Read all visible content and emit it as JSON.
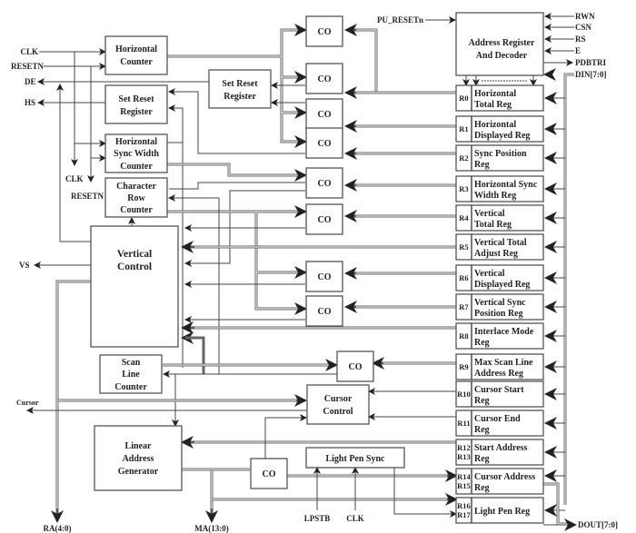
{
  "diagram": {
    "blocks": {
      "horizontal_counter": [
        "Horizontal",
        "Counter"
      ],
      "set_reset_register_1": [
        "Set Reset",
        "Register"
      ],
      "set_reset_register_2": [
        "Set Reset",
        "Register"
      ],
      "hsync_width_counter": [
        "Horizontal",
        "Sync Width",
        "Counter"
      ],
      "char_row_counter": [
        "Character",
        "Row",
        "Counter"
      ],
      "vertical_control": [
        "Vertical",
        "Control"
      ],
      "scan_line_counter": [
        "Scan",
        "Line",
        "Counter"
      ],
      "cursor_control": [
        "Cursor",
        "Control"
      ],
      "linear_address_generator": [
        "Linear",
        "Address",
        "Generator"
      ],
      "light_pen_sync": "Light Pen Sync",
      "address_register_decoder": [
        "Address Register",
        "And Decoder"
      ],
      "comparator": "CO"
    },
    "registers": [
      {
        "id": "R0",
        "name": [
          "Horizontal",
          "Total Reg"
        ]
      },
      {
        "id": "R1",
        "name": [
          "Horizontal",
          "Displayed Reg"
        ]
      },
      {
        "id": "R2",
        "name": [
          "Sync Position",
          "Reg"
        ]
      },
      {
        "id": "R3",
        "name": [
          "Horizontal Sync",
          "Width Reg"
        ]
      },
      {
        "id": "R4",
        "name": [
          "Vertical",
          "Total Reg"
        ]
      },
      {
        "id": "R5",
        "name": [
          "Vertical Total",
          "Adjust Reg"
        ]
      },
      {
        "id": "R6",
        "name": [
          "Vertical",
          "Displayed Reg"
        ]
      },
      {
        "id": "R7",
        "name": [
          "Vertical Sync",
          "Position Reg"
        ]
      },
      {
        "id": "R8",
        "name": [
          "Interlace Mode",
          "Reg"
        ]
      },
      {
        "id": "R9",
        "name": [
          "Max Scan Line",
          "Address Reg"
        ]
      },
      {
        "id": "R10",
        "name": [
          "Cursor Start",
          "Reg"
        ]
      },
      {
        "id": "R11",
        "name": [
          "Cursor End",
          "Reg"
        ]
      },
      {
        "id": "R12 R13",
        "ids": [
          "R12",
          "R13"
        ],
        "name": [
          "Start Address",
          "Reg"
        ]
      },
      {
        "id": "R14 R15",
        "ids": [
          "R14",
          "R15"
        ],
        "name": [
          "Cursor Address",
          "Reg"
        ]
      },
      {
        "id": "R16 R17",
        "ids": [
          "R16",
          "R17"
        ],
        "name": [
          "Light Pen Reg"
        ]
      }
    ],
    "signals": {
      "clk": "CLK",
      "resetn": "RESETN",
      "de": "DE",
      "hs": "HS",
      "vs": "VS",
      "clk2": "CLK",
      "resetn2": "RESETN",
      "cursor": "Cursor",
      "ra": "RA(4:0)",
      "ma": "MA(13:0)",
      "lpstb": "LPSTB",
      "clk3": "CLK",
      "pu_resetn": "PU_RESETn",
      "rwn": "RWN",
      "csn": "CSN",
      "rs": "RS",
      "e": "E",
      "pdbtri": "PDBTRI",
      "din": "DIN[7:0]",
      "dout": "DOUT[7:0]"
    }
  }
}
